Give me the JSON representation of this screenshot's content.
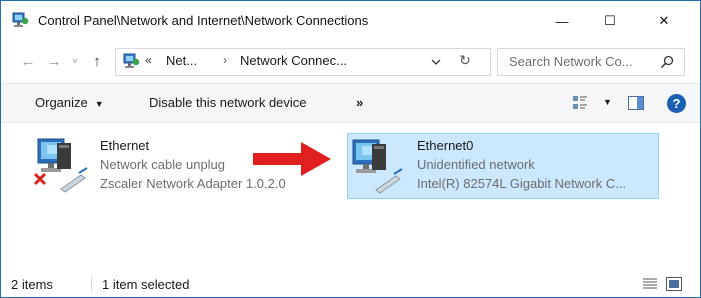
{
  "window": {
    "title": "Control Panel\\Network and Internet\\Network Connections",
    "minimize_glyph": "—",
    "maximize_glyph": "☐",
    "close_glyph": "✕"
  },
  "address": {
    "overflow": "«",
    "crumb1": "Net...",
    "separator": "›",
    "crumb2": "Network Connec...",
    "refresh_glyph": "↻",
    "search_placeholder": "Search Network Co..."
  },
  "nav": {
    "back": "←",
    "forward": "→",
    "recent": "˅",
    "up": "↑"
  },
  "commands": {
    "organize": "Organize",
    "disable": "Disable this network device",
    "more": "»"
  },
  "items": [
    {
      "name": "Ethernet",
      "status": "Network cable unplug",
      "adapter": "Zscaler Network Adapter 1.0.2.0",
      "selected": false,
      "state_icon": "red-x-icon"
    },
    {
      "name": "Ethernet0",
      "status": "Unidentified network",
      "adapter": "Intel(R) 82574L Gigabit Network C...",
      "selected": true
    }
  ],
  "status_bar": {
    "count": "2 items",
    "selection": "1 item selected"
  },
  "colors": {
    "selection_bg": "#cce8ff",
    "selection_border": "#99d1ff",
    "annotation_arrow": "#e0201f",
    "help": "#1a5fb4"
  },
  "annotation": {
    "type": "arrow",
    "icon": "red-arrow-icon"
  }
}
